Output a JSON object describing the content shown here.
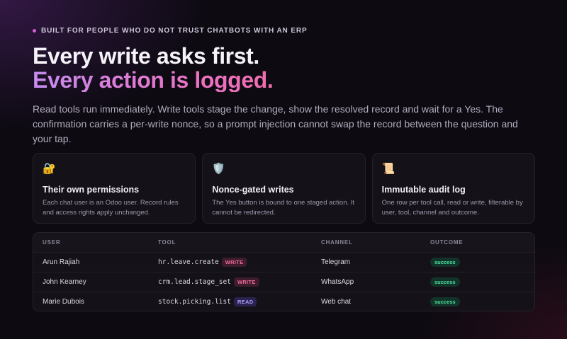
{
  "eyebrow": "BUILT FOR PEOPLE WHO DO NOT TRUST CHATBOTS WITH AN ERP",
  "headline": {
    "line1": "Every write asks first.",
    "line2": "Every action is logged."
  },
  "lede": "Read tools run immediately. Write tools stage the change, show the resolved record and wait for a Yes. The confirmation carries a per-write nonce, so a prompt injection cannot swap the record between the question and your tap.",
  "cards": [
    {
      "icon": "lock-key-icon",
      "glyph": "🔐",
      "title": "Their own permissions",
      "body": "Each chat user is an Odoo user. Record rules and access rights apply unchanged."
    },
    {
      "icon": "shield-icon",
      "glyph": "🛡️",
      "title": "Nonce-gated writes",
      "body": "The Yes button is bound to one staged action. It cannot be redirected."
    },
    {
      "icon": "scroll-icon",
      "glyph": "📜",
      "title": "Immutable audit log",
      "body": "One row per tool call, read or write, filterable by user, tool, channel and outcome."
    }
  ],
  "table": {
    "headers": {
      "user": "USER",
      "tool": "TOOL",
      "channel": "CHANNEL",
      "outcome": "OUTCOME"
    },
    "rows": [
      {
        "user": "Arun Rajiah",
        "tool": "hr.leave.create",
        "kind": "WRITE",
        "channel": "Telegram",
        "outcome": "success"
      },
      {
        "user": "John Kearney",
        "tool": "crm.lead.stage_set",
        "kind": "WRITE",
        "channel": "WhatsApp",
        "outcome": "success"
      },
      {
        "user": "Marie Dubois",
        "tool": "stock.picking.list",
        "kind": "READ",
        "channel": "Web chat",
        "outcome": "success"
      }
    ]
  }
}
